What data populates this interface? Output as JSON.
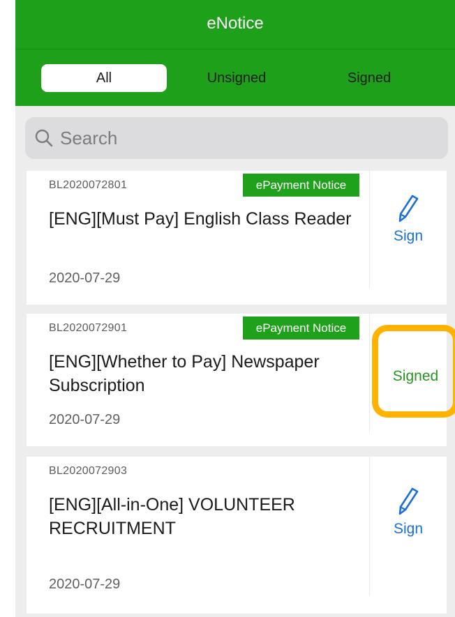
{
  "header": {
    "title": "eNotice",
    "tabs": [
      {
        "label": "All",
        "selected": true
      },
      {
        "label": "Unsigned",
        "selected": false
      },
      {
        "label": "Signed",
        "selected": false
      }
    ]
  },
  "search": {
    "placeholder": "Search",
    "value": ""
  },
  "notices": [
    {
      "ref": "BL2020072801",
      "badge": "ePayment Notice",
      "title": "[ENG][Must Pay] English Class Reader",
      "date": "2020-07-29",
      "action_label": "Sign"
    },
    {
      "ref": "BL2020072901",
      "badge": "ePayment Notice",
      "title": "[ENG][Whether to Pay] Newspaper Subscription",
      "date": "2020-07-29",
      "status_label": "Signed"
    },
    {
      "ref": "BL2020072903",
      "title": "[ENG][All-in-One] VOLUNTEER RECRUITMENT",
      "date": "2020-07-29",
      "action_label": "Sign"
    }
  ],
  "colors": {
    "header_green": "#1fa01a",
    "badge_green": "#20a11b",
    "sign_blue": "#1b6fd6",
    "signed_green": "#23961f",
    "highlight_orange": "#ffb300"
  }
}
